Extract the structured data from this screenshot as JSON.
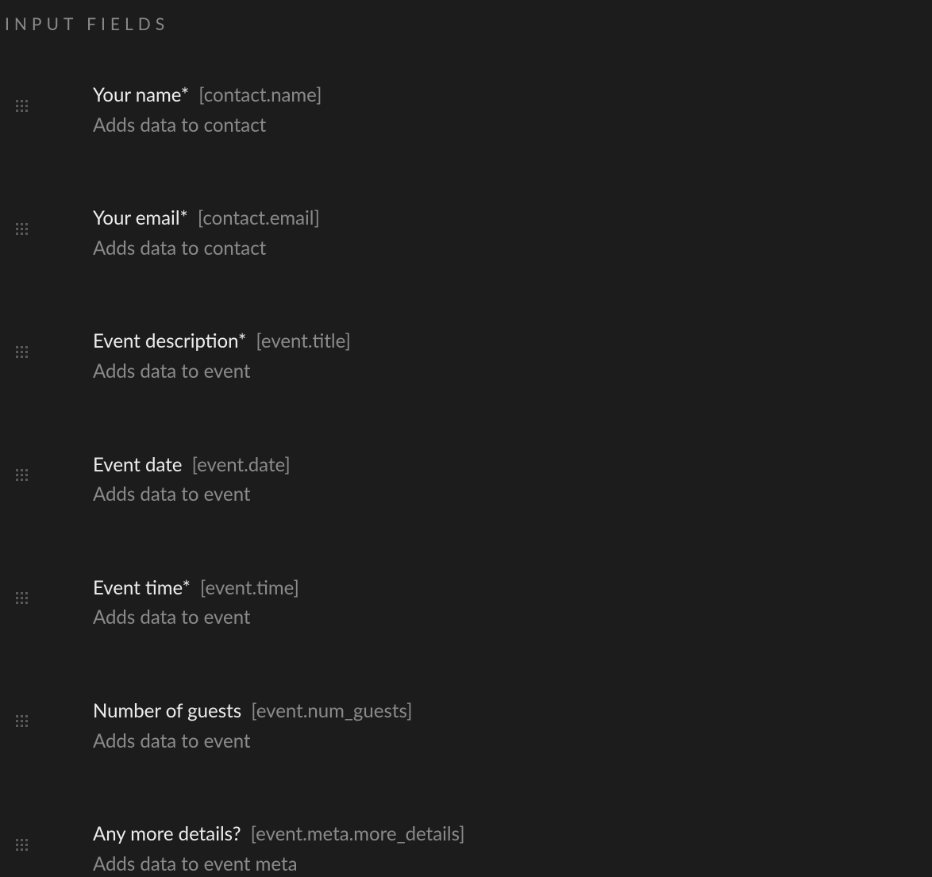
{
  "section_title": "INPUT FIELDS",
  "fields": [
    {
      "label": "Your name",
      "required": true,
      "key": "[contact.name]",
      "description": "Adds data to contact"
    },
    {
      "label": "Your email",
      "required": true,
      "key": "[contact.email]",
      "description": "Adds data to contact"
    },
    {
      "label": "Event description",
      "required": true,
      "key": "[event.title]",
      "description": "Adds data to event"
    },
    {
      "label": "Event date",
      "required": false,
      "key": "[event.date]",
      "description": "Adds data to event"
    },
    {
      "label": "Event time",
      "required": true,
      "key": "[event.time]",
      "description": "Adds data to event"
    },
    {
      "label": "Number of guests",
      "required": false,
      "key": "[event.num_guests]",
      "description": "Adds data to event"
    },
    {
      "label": "Any more details?",
      "required": false,
      "key": "[event.meta.more_details]",
      "description": "Adds data to event meta"
    }
  ]
}
